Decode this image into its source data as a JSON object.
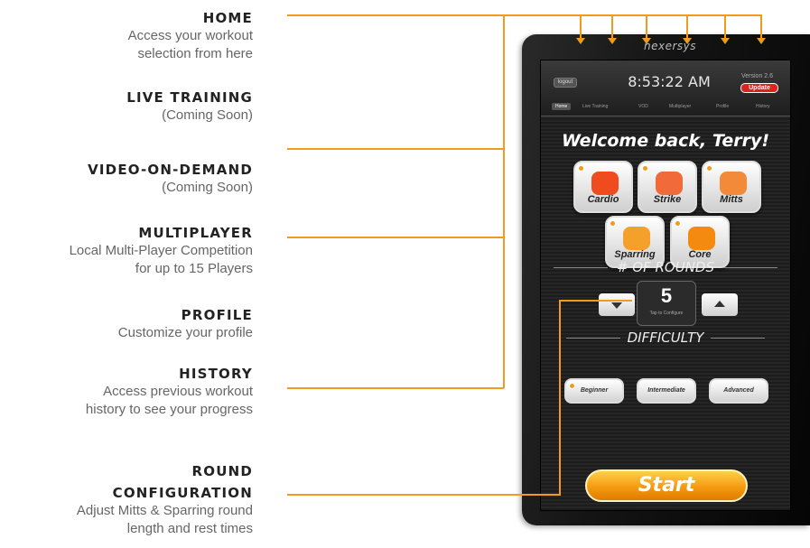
{
  "annotations": [
    {
      "title": "HOME",
      "desc": [
        "Access your workout",
        "selection from here"
      ]
    },
    {
      "title": "LIVE TRAINING",
      "desc": [
        "(Coming Soon)"
      ]
    },
    {
      "title": "VIDEO-ON-DEMAND",
      "desc": [
        "(Coming Soon)"
      ]
    },
    {
      "title": "MULTIPLAYER",
      "desc": [
        "Local Multi-Player Competition",
        "for up to 15 Players"
      ]
    },
    {
      "title": "PROFILE",
      "desc": [
        "Customize your profile"
      ]
    },
    {
      "title": "HISTORY",
      "desc": [
        "Access previous workout",
        "history to see your progress"
      ]
    },
    {
      "title": [
        "ROUND",
        "CONFIGURATION"
      ],
      "desc": [
        "Adjust Mitts & Sparring round",
        "length and rest times"
      ]
    }
  ],
  "device": {
    "brand": "nexersys",
    "screen": {
      "logout": "logout",
      "clock": "8:53:22 AM",
      "version": "Version 2.6",
      "update": "Update",
      "tabs": [
        "Home",
        "Live Training",
        "VOD",
        "Multiplayer",
        "Profile",
        "History"
      ],
      "active_tab": "Home",
      "welcome": "Welcome back, Terry!",
      "modes": [
        "Cardio",
        "Strike",
        "Mitts",
        "Sparring",
        "Core"
      ],
      "rounds_heading": "# OF ROUNDS",
      "rounds_value": "5",
      "rounds_sub": "Tap to Configure",
      "difficulty_heading": "DIFFICULTY",
      "difficulty_options": [
        "Beginner",
        "Intermediate",
        "Advanced"
      ],
      "selected_difficulty": "Beginner",
      "start": "Start"
    }
  },
  "colors": {
    "connector": "#f39a1e",
    "accent": "#f5a21b"
  }
}
